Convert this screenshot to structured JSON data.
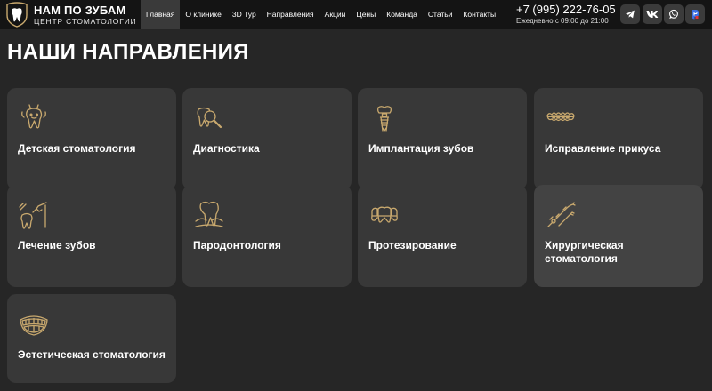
{
  "brand": {
    "title": "НАМ ПО ЗУБАМ",
    "subtitle": "ЦЕНТР СТОМАТОЛОГИИ",
    "accent": "#c9a96e"
  },
  "nav": {
    "items": [
      {
        "label": "Главная",
        "active": true
      },
      {
        "label": "О клинике"
      },
      {
        "label": "3D Тур"
      },
      {
        "label": "Направления"
      },
      {
        "label": "Акции"
      },
      {
        "label": "Цены"
      },
      {
        "label": "Команда"
      },
      {
        "label": "Статьи"
      },
      {
        "label": "Контакты"
      }
    ]
  },
  "contact": {
    "phone": "+7 (995) 222-76-05",
    "hours": "Ежедневно с 09:00 до 21:00"
  },
  "social": [
    {
      "name": "telegram-icon"
    },
    {
      "name": "vk-icon"
    },
    {
      "name": "whatsapp-icon"
    },
    {
      "name": "messenger-icon"
    }
  ],
  "main": {
    "title": "НАШИ НАПРАВЛЕНИЯ",
    "cards": [
      {
        "label": "Детская стоматология",
        "icon": "child-tooth-icon"
      },
      {
        "label": "Диагностика",
        "icon": "diagnostics-icon"
      },
      {
        "label": "Имплантация зубов",
        "icon": "implant-icon"
      },
      {
        "label": "Исправление прикуса",
        "icon": "braces-icon"
      },
      {
        "label": "Лечение зубов",
        "icon": "dental-drill-icon"
      },
      {
        "label": "Пародонтология",
        "icon": "gum-tooth-icon"
      },
      {
        "label": "Протезирование",
        "icon": "prosthesis-icon"
      },
      {
        "label": "Хирургическая стоматология",
        "icon": "dental-tools-icon",
        "highlighted": true
      },
      {
        "label": "Эстетическая стоматология",
        "icon": "smile-teeth-icon"
      }
    ]
  },
  "colors": {
    "background": "#262626",
    "header": "#141414",
    "card": "#383838",
    "card_highlight": "#434343",
    "icon_gold": "#c9a96e"
  }
}
